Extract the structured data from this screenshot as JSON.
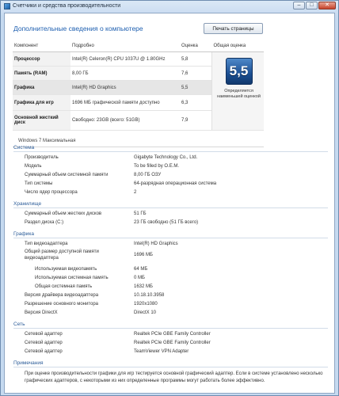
{
  "window": {
    "title": "Счетчики и средства производительности",
    "min_label": "–",
    "max_label": "□",
    "close_label": "✕"
  },
  "page": {
    "title": "Дополнительные сведения о компьютере",
    "print_button": "Печать страницы"
  },
  "score_table": {
    "headers": [
      "Компонент",
      "Подробно",
      "Оценка",
      "Общая оценка"
    ],
    "rows": [
      {
        "component": "Процессор",
        "details": "Intel(R) Celeron(R) CPU 1037U @ 1.80GHz",
        "score": "5,8"
      },
      {
        "component": "Память (RAM)",
        "details": "8,00 ГБ",
        "score": "7,6"
      },
      {
        "component": "Графика",
        "details": "Intel(R) HD Graphics",
        "score": "5,5"
      },
      {
        "component": "Графика для игр",
        "details": "1696 МБ графической памяти доступно",
        "score": "6,3"
      },
      {
        "component": "Основной жесткий диск",
        "details": "Свободно: 23GB (всего: 51GB)",
        "score": "7,9"
      }
    ],
    "base_score": "5,5",
    "base_score_note": "Определяется наименьшей оценкой",
    "os": "Windows 7 Максимальная"
  },
  "system": {
    "title": "Система",
    "rows": [
      {
        "k": "Производитель",
        "v": "Gigabyte Technology Co., Ltd."
      },
      {
        "k": "Модель",
        "v": "To be filled by O.E.M."
      },
      {
        "k": "Суммарный объем системной памяти",
        "v": "8,00 ГБ ОЗУ"
      },
      {
        "k": "Тип системы",
        "v": "64-разрядная операционная система"
      },
      {
        "k": "Число ядер процессора",
        "v": "2"
      }
    ]
  },
  "storage": {
    "title": "Хранилище",
    "rows": [
      {
        "k": "Суммарный объем жестких дисков",
        "v": "51 ГБ"
      },
      {
        "k": "Раздел диска (C:)",
        "v": "23 ГБ свободно (51 ГБ всего)"
      }
    ]
  },
  "graphics": {
    "title": "Графика",
    "rows": [
      {
        "k": "Тип видеоадаптера",
        "v": "Intel(R) HD Graphics"
      },
      {
        "k": "Общий размер доступной памяти видеоадаптера",
        "v": "1696 МБ"
      },
      {
        "k": "Используемая видеопамять",
        "v": "64 МБ"
      },
      {
        "k": "Используемая системная память",
        "v": "0 МБ"
      },
      {
        "k": "Общая системная память",
        "v": "1632 МБ"
      },
      {
        "k": "Версия драйвера видеоадаптера",
        "v": "10.18.10.3958"
      },
      {
        "k": "Разрешение основного монитора",
        "v": "1920x1080"
      },
      {
        "k": "Версия DirectX",
        "v": "DirectX 10"
      }
    ]
  },
  "network": {
    "title": "Сеть",
    "rows": [
      {
        "k": "Сетевой адаптер",
        "v": "Realtek PCIe GBE Family Controller"
      },
      {
        "k": "Сетевой адаптер",
        "v": "Realtek PCIe GBE Family Controller"
      },
      {
        "k": "Сетевой адаптер",
        "v": "TeamViewer VPN Adapter"
      }
    ]
  },
  "notes": {
    "title": "Примечания",
    "text": "При оценке производительности графики для игр тестируется основной графический адаптер. Если в системе установлено несколько графических адаптеров, с некоторыми из них определенные программы могут работать более эффективно."
  }
}
